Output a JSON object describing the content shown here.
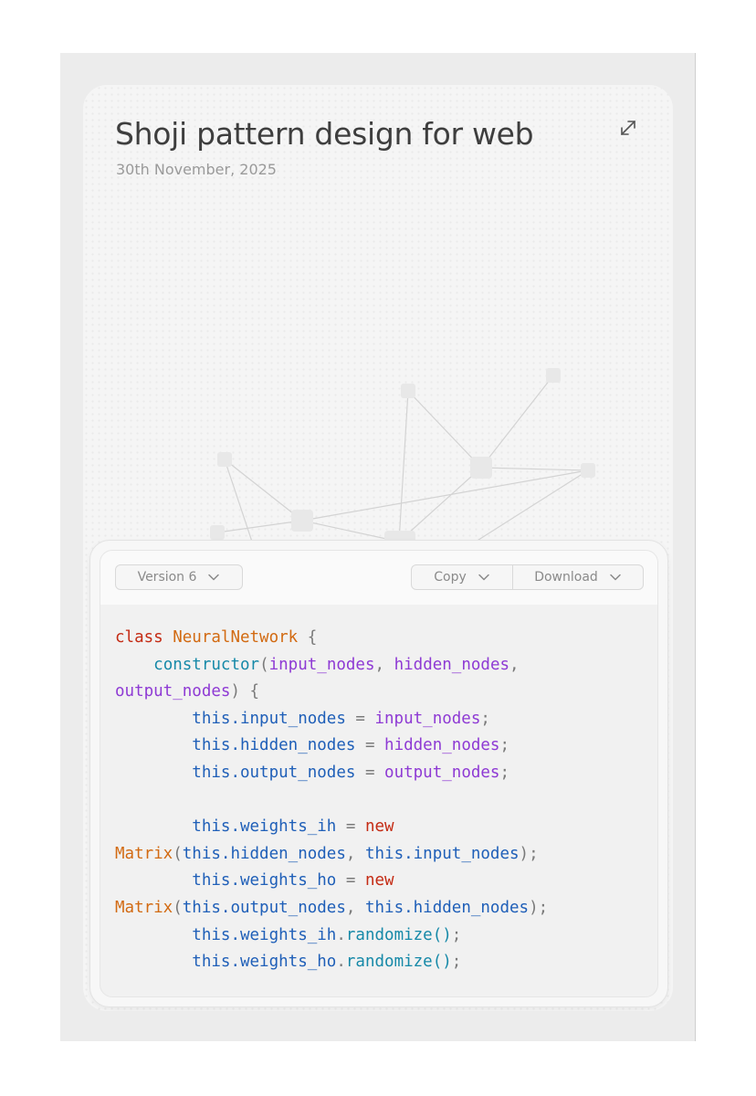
{
  "card": {
    "title": "Shoji pattern design for web",
    "date": "30th November, 2025"
  },
  "toolbar": {
    "version_label": "Version 6",
    "copy_label": "Copy",
    "download_label": "Download"
  },
  "icons": {
    "expand": "expand-icon",
    "chevron": "chevron-down-icon"
  },
  "colors": {
    "keyword": "#c42b14",
    "class_name": "#d26a12",
    "function": "#1689a8",
    "parameter": "#8e3ad4",
    "property": "#1f5fb8"
  },
  "code": {
    "lines": [
      [
        [
          "kw",
          "class"
        ],
        [
          "plain",
          " "
        ],
        [
          "cls",
          "NeuralNetwork"
        ],
        [
          "plain",
          " {"
        ]
      ],
      [
        [
          "plain",
          "    "
        ],
        [
          "fn",
          "constructor"
        ],
        [
          "plain",
          "("
        ],
        [
          "param",
          "input_nodes"
        ],
        [
          "plain",
          ", "
        ],
        [
          "param",
          "hidden_nodes"
        ],
        [
          "plain",
          ","
        ]
      ],
      [
        [
          "param",
          "output_nodes"
        ],
        [
          "plain",
          ") {"
        ]
      ],
      [
        [
          "plain",
          "        "
        ],
        [
          "prop",
          "this.input_nodes"
        ],
        [
          "plain",
          " = "
        ],
        [
          "param",
          "input_nodes"
        ],
        [
          "plain",
          ";"
        ]
      ],
      [
        [
          "plain",
          "        "
        ],
        [
          "prop",
          "this.hidden_nodes"
        ],
        [
          "plain",
          " = "
        ],
        [
          "param",
          "hidden_nodes"
        ],
        [
          "plain",
          ";"
        ]
      ],
      [
        [
          "plain",
          "        "
        ],
        [
          "prop",
          "this.output_nodes"
        ],
        [
          "plain",
          " = "
        ],
        [
          "param",
          "output_nodes"
        ],
        [
          "plain",
          ";"
        ]
      ],
      [],
      [
        [
          "plain",
          "        "
        ],
        [
          "prop",
          "this.weights_ih"
        ],
        [
          "plain",
          " = "
        ],
        [
          "kw",
          "new"
        ]
      ],
      [
        [
          "cls",
          "Matrix"
        ],
        [
          "plain",
          "("
        ],
        [
          "prop",
          "this.hidden_nodes"
        ],
        [
          "plain",
          ", "
        ],
        [
          "prop",
          "this.input_nodes"
        ],
        [
          "plain",
          ");"
        ]
      ],
      [
        [
          "plain",
          "        "
        ],
        [
          "prop",
          "this.weights_ho"
        ],
        [
          "plain",
          " = "
        ],
        [
          "kw",
          "new"
        ]
      ],
      [
        [
          "cls",
          "Matrix"
        ],
        [
          "plain",
          "("
        ],
        [
          "prop",
          "this.output_nodes"
        ],
        [
          "plain",
          ", "
        ],
        [
          "prop",
          "this.hidden_nodes"
        ],
        [
          "plain",
          ");"
        ]
      ],
      [
        [
          "plain",
          "        "
        ],
        [
          "prop",
          "this.weights_ih"
        ],
        [
          "plain",
          "."
        ],
        [
          "fn",
          "randomize()"
        ],
        [
          "plain",
          ";"
        ]
      ],
      [
        [
          "plain",
          "        "
        ],
        [
          "prop",
          "this.weights_ho"
        ],
        [
          "plain",
          "."
        ],
        [
          "fn",
          "randomize()"
        ],
        [
          "plain",
          ";"
        ]
      ]
    ]
  }
}
